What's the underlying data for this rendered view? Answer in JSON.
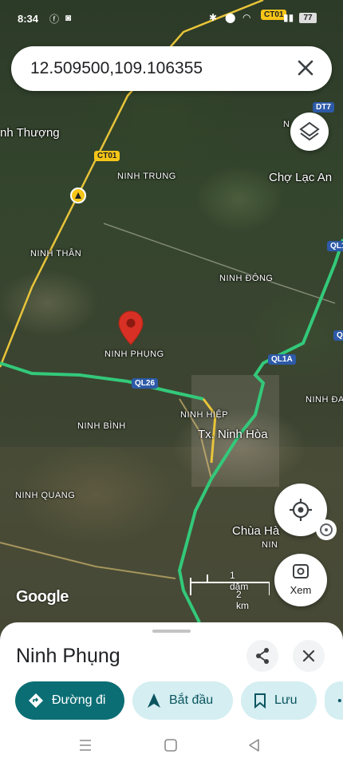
{
  "status_bar": {
    "time": "8:34",
    "signal_badge": "CT01",
    "battery": "77"
  },
  "search": {
    "query": "12.509500,109.106355"
  },
  "map": {
    "places": [
      {
        "id": "ninh-thuong",
        "label": "nh Thượng"
      },
      {
        "id": "ninh-trung",
        "label": "NINH TRUNG"
      },
      {
        "id": "cho-lac-an",
        "label": "Chợ Lạc An"
      },
      {
        "id": "ninh-than",
        "label": "NINH THÂN"
      },
      {
        "id": "ninh-dong",
        "label": "NINH ĐÔNG"
      },
      {
        "id": "ninh-phung",
        "label": "NINH PHỤNG"
      },
      {
        "id": "ninh-hiep",
        "label": "NINH HIỆP"
      },
      {
        "id": "tx-ninh-hoa",
        "label": "Tx. Ninh Hòa"
      },
      {
        "id": "ninh-binh",
        "label": "NINH BÌNH"
      },
      {
        "id": "ninh-quang",
        "label": "NINH QUANG"
      },
      {
        "id": "ninh-da",
        "label": "NINH ĐA"
      },
      {
        "id": "chua-ha",
        "label": "Chùa Hà"
      },
      {
        "id": "n-right",
        "label": "N"
      },
      {
        "id": "nin-bottom",
        "label": "NIN"
      }
    ],
    "roads": {
      "ct01_a": "CT01",
      "ct01_b": "CT01",
      "dt7": "DT7",
      "ql1": "QL1",
      "ql1a": "QL1A",
      "ql26": "QL26",
      "ql_right": "QL"
    },
    "attribution": "Google",
    "scale_top": "1 dặm",
    "scale_bottom": "2 km",
    "xem_label": "Xem"
  },
  "sheet": {
    "title": "Ninh Phụng",
    "actions": {
      "directions": "Đường đi",
      "start": "Bắt đầu",
      "save": "Lưu"
    }
  },
  "colors": {
    "primary": "#0b6e75",
    "chip_bg": "#d4eef1",
    "pin": "#d93025",
    "route": "#2ecc71"
  }
}
